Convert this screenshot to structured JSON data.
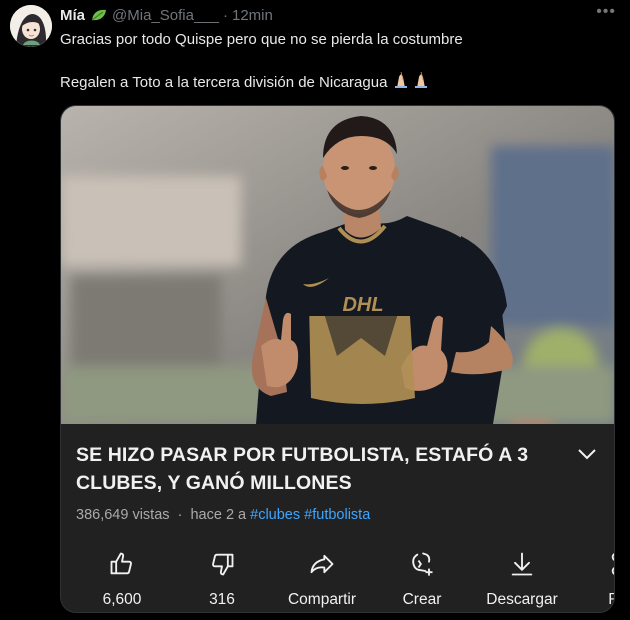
{
  "tweet": {
    "author_name": "Mía",
    "author_handle": "@Mia_Sofia___",
    "separator": "·",
    "time": "12min",
    "more_label": "•••",
    "line1": "Gracias por todo Quispe pero que no se pierda la costumbre",
    "line2": "Regalen a Toto a la tercera división de Nicaragua"
  },
  "video": {
    "jersey_sponsor": "DHL",
    "title_line1": "SE HIZO PASAR POR FUTBOLISTA, ESTAFÓ A 3",
    "title_line2": "CLUBES, Y GANÓ MILLONES",
    "views": "386,649 vistas",
    "age": "hace 2 a",
    "hashtags": [
      "#clubes",
      "#futbolista"
    ],
    "actions": [
      {
        "icon": "thumbs-up-icon",
        "label": "6,600"
      },
      {
        "icon": "thumbs-down-icon",
        "label": "316"
      },
      {
        "icon": "share-icon",
        "label": "Compartir"
      },
      {
        "icon": "remix-icon",
        "label": "Crear"
      },
      {
        "icon": "download-icon",
        "label": "Descargar"
      },
      {
        "icon": "scissors-icon",
        "label": "Rec"
      }
    ]
  },
  "colors": {
    "background": "#000000",
    "text": "#e7e9ea",
    "muted": "#71767b",
    "card": "#212121",
    "hashtag": "#3ea6ff",
    "jersey": "#141821",
    "jersey_gold": "#b08f55"
  }
}
